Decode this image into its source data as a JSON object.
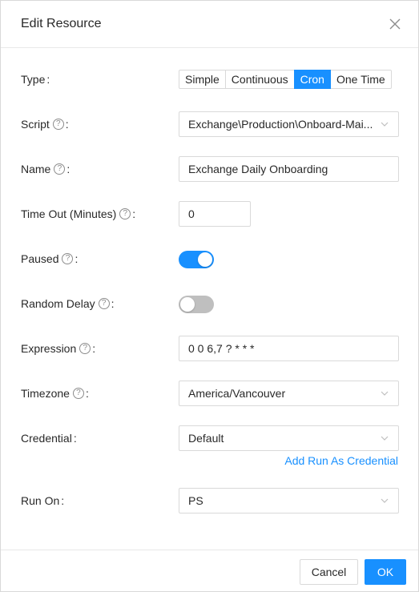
{
  "dialog": {
    "title": "Edit Resource",
    "close_icon": "close-icon"
  },
  "fields": {
    "type": {
      "label": "Type",
      "colon": ":",
      "options": [
        "Simple",
        "Continuous",
        "Cron",
        "One Time"
      ],
      "selected": "Cron"
    },
    "script": {
      "label": "Script",
      "colon": ":",
      "value": "Exchange\\Production\\Onboard-Mai..."
    },
    "name": {
      "label": "Name",
      "colon": ":",
      "value": "Exchange Daily Onboarding"
    },
    "timeout": {
      "label": "Time Out (Minutes)",
      "colon": ":",
      "value": "0"
    },
    "paused": {
      "label": "Paused",
      "colon": ":",
      "checked": true
    },
    "random_delay": {
      "label": "Random Delay",
      "colon": ":",
      "checked": false
    },
    "expression": {
      "label": "Expression",
      "colon": ":",
      "value": "0 0 6,7 ? * * *"
    },
    "timezone": {
      "label": "Timezone",
      "colon": ":",
      "value": "America/Vancouver"
    },
    "credential": {
      "label": "Credential",
      "colon": ":",
      "value": "Default",
      "link": "Add Run As Credential"
    },
    "run_on": {
      "label": "Run On",
      "colon": ":",
      "value": "PS"
    }
  },
  "help_glyph": "?",
  "footer": {
    "cancel_label": "Cancel",
    "ok_label": "OK"
  },
  "colors": {
    "primary": "#1890ff",
    "switch_off": "#bfbfbf",
    "border": "#d9d9d9"
  }
}
